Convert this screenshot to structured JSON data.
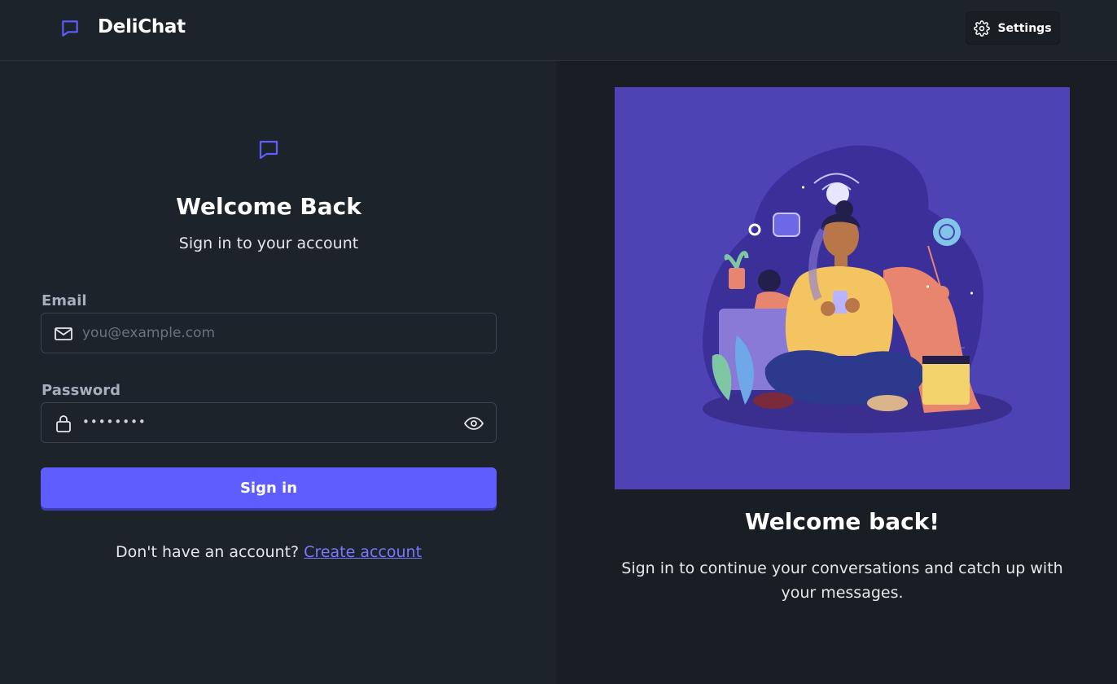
{
  "header": {
    "brand_name": "DeliChat",
    "brand_icon": "chat-bubble-icon",
    "settings_label": "Settings",
    "settings_icon": "gear-icon"
  },
  "login": {
    "icon": "chat-bubble-icon",
    "title": "Welcome Back",
    "subtitle": "Sign in to your account",
    "email": {
      "label": "Email",
      "placeholder": "you@example.com",
      "value": "",
      "icon": "mail-icon"
    },
    "password": {
      "label": "Password",
      "masked_value": "••••••••",
      "icon": "lock-icon",
      "toggle_icon": "eye-icon"
    },
    "submit_label": "Sign in",
    "signup_prompt": "Don't have an account?",
    "signup_link": "Create account"
  },
  "promo": {
    "illustration": "person-chatting-illustration",
    "title": "Welcome back!",
    "text": "Sign in to continue your conversations and catch up with your messages."
  },
  "colors": {
    "accent": "#605dff",
    "link": "#7b78ff",
    "background": "#1d232a",
    "panel": "#191e24",
    "illustration_bg": "#4e43b4"
  }
}
